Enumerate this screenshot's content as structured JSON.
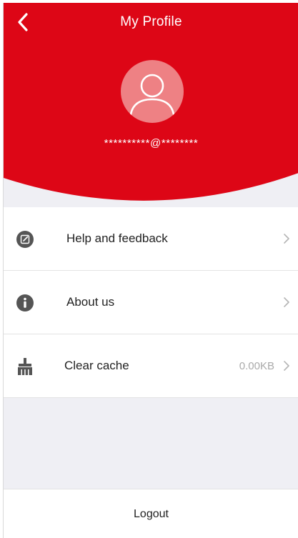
{
  "header": {
    "title": "My Profile",
    "back_icon": "chevron-left-icon",
    "background_color": "#dd0616",
    "email": "**********@********"
  },
  "avatar": {
    "icon": "user-avatar-icon",
    "background_color": "#ee8184"
  },
  "menu": {
    "items": [
      {
        "label": "Help and feedback",
        "icon": "edit-icon",
        "value": ""
      },
      {
        "label": "About us",
        "icon": "info-icon",
        "value": ""
      },
      {
        "label": "Clear cache",
        "icon": "broom-icon",
        "value": "0.00KB"
      }
    ]
  },
  "footer": {
    "logout_label": "Logout"
  }
}
